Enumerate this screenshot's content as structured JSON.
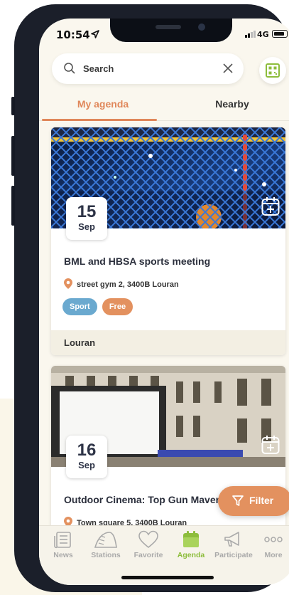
{
  "status": {
    "time": "10:54",
    "network": "4G"
  },
  "search": {
    "placeholder": "Search"
  },
  "tabs": [
    {
      "label": "My agenda"
    },
    {
      "label": "Nearby"
    }
  ],
  "events": [
    {
      "day": "15",
      "month": "Sep",
      "title": "BML and HBSA sports meeting",
      "location": "street gym 2, 3400B Louran",
      "tags": [
        {
          "label": "Sport",
          "color": "#6aa9cf"
        },
        {
          "label": "Free",
          "color": "#e3915f"
        }
      ],
      "footer": "Louran"
    },
    {
      "day": "16",
      "month": "Sep",
      "title": "Outdoor Cinema: Top Gun Maverick",
      "location": "Town square 5, 3400B Louran"
    }
  ],
  "filter": {
    "label": "Filter"
  },
  "nav": [
    {
      "label": "News",
      "icon": "news-icon"
    },
    {
      "label": "Stations",
      "icon": "stations-icon"
    },
    {
      "label": "Favorite",
      "icon": "heart-icon"
    },
    {
      "label": "Agenda",
      "icon": "agenda-icon",
      "active": true
    },
    {
      "label": "Participate",
      "icon": "megaphone-icon"
    },
    {
      "label": "More",
      "icon": "more-icon"
    }
  ],
  "colors": {
    "accent": "#e0875a",
    "active_nav": "#8dbd3c",
    "sport_tag": "#6aa9cf",
    "free_tag": "#e3915f"
  }
}
